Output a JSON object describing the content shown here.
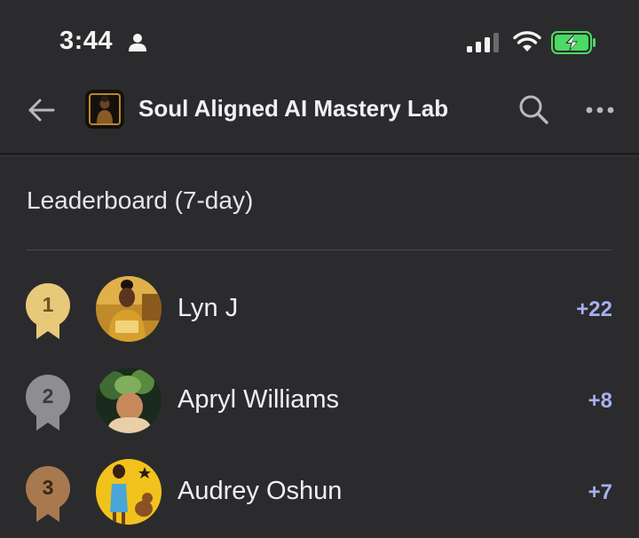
{
  "status_bar": {
    "time": "3:44",
    "signal_bars_filled": 3,
    "signal_bars_total": 4,
    "battery_charging": true
  },
  "nav": {
    "title": "Soul Aligned AI Mastery Lab",
    "back_icon": "arrow-left-icon",
    "search_icon": "search-icon",
    "more_icon": "ellipsis-icon"
  },
  "leaderboard": {
    "title": "Leaderboard (7-day)",
    "entries": [
      {
        "rank": "1",
        "name": "Lyn J",
        "points": "+22",
        "medal_color": "#e8c879",
        "rank_color": "#6b5420"
      },
      {
        "rank": "2",
        "name": "Apryl Williams",
        "points": "+8",
        "medal_color": "#8e8e92",
        "rank_color": "#3a3a3d"
      },
      {
        "rank": "3",
        "name": "Audrey Oshun",
        "points": "+7",
        "medal_color": "#a8784e",
        "rank_color": "#3a2616"
      }
    ]
  },
  "colors": {
    "background": "#2b2b2d",
    "points": "#a5b1f0",
    "battery_green": "#4cd964"
  }
}
